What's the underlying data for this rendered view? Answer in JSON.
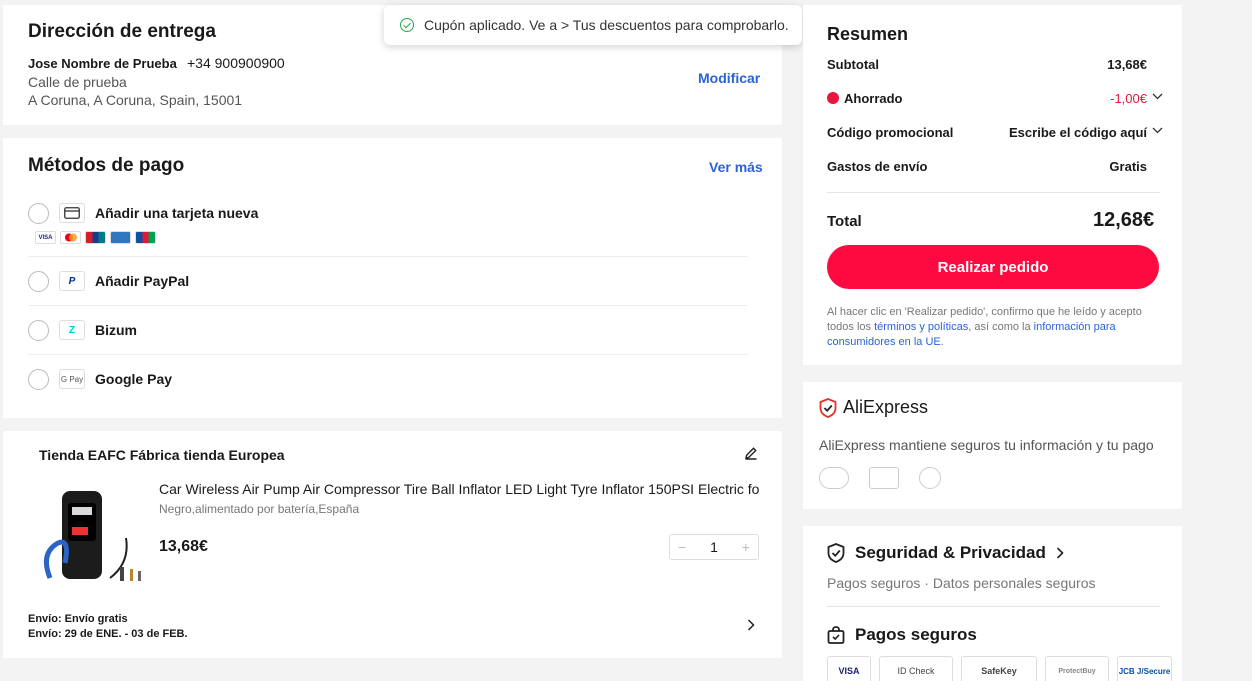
{
  "toast": {
    "text": "Cupón aplicado. Ve a > Tus descuentos para comprobarlo."
  },
  "address": {
    "title": "Dirección de entrega",
    "name": "Jose Nombre de Prueba",
    "phone": "+34 900900900",
    "line1": "Calle de prueba",
    "line2": "A Coruna, A Coruna, Spain, 15001",
    "modify_label": "Modificar"
  },
  "payment": {
    "title": "Métodos de pago",
    "more_label": "Ver más",
    "methods": [
      {
        "label": "Añadir una tarjeta nueva",
        "icon": "card-icon"
      },
      {
        "label": "Añadir PayPal",
        "icon": "paypal-icon"
      },
      {
        "label": "Bizum",
        "icon": "bizum-icon"
      },
      {
        "label": "Google Pay",
        "icon": "google-pay-icon",
        "icon_text": "G Pay"
      }
    ],
    "brands": [
      "VISA",
      "MC",
      "UP",
      "AMEX",
      "JCB"
    ]
  },
  "store": {
    "name": "Tienda EAFC Fábrica tienda Europea",
    "product_title": "Car Wireless Air Pump Air Compressor Tire Ball Inflator LED Light Tyre Inflator 150PSI Electric fo",
    "variant": "Negro,alimentado por batería,España",
    "price": "13,68€",
    "quantity": "1",
    "shipping_line1": "Envío: Envío gratis",
    "shipping_line2": "Envío: 29 de ENE. - 03 de FEB."
  },
  "summary": {
    "title": "Resumen",
    "subtotal_label": "Subtotal",
    "subtotal_value": "13,68€",
    "saved_label": "Ahorrado",
    "saved_value": "-1,00€",
    "promo_label": "Código promocional",
    "promo_value": "Escribe el código aquí",
    "shipping_label": "Gastos de envío",
    "shipping_value": "Gratis",
    "total_label": "Total",
    "total_value": "12,68€",
    "order_button": "Realizar pedido",
    "legal_prefix": "Al hacer clic en 'Realizar pedido', confirmo que he leído y acepto todos los ",
    "legal_link1": "términos y políticas",
    "legal_middle": ", así como la ",
    "legal_link2": "información para consumidores en la UE",
    "legal_suffix": "."
  },
  "aliexpress": {
    "brand": "AliExpress",
    "description": "AliExpress mantiene seguros tu información y tu pago"
  },
  "security": {
    "title": "Seguridad & Privacidad",
    "subtitle": "Pagos seguros · Datos personales seguros",
    "payments_title": "Pagos seguros",
    "badges": [
      "VISA",
      "ID Check",
      "SafeKey",
      "ProtectBuy",
      "JCB J/Secure"
    ]
  },
  "colors": {
    "accent": "#fd0a40",
    "link": "#2b62d9",
    "saved": "#e8153f",
    "success": "#27a84a"
  }
}
